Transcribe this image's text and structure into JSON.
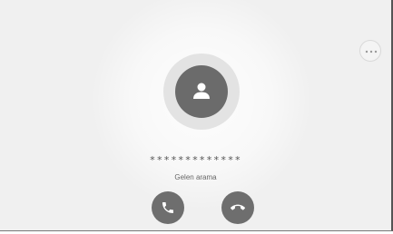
{
  "call": {
    "caller_number": "*************",
    "status": "Gelen arama"
  },
  "icons": {
    "avatar": "person-icon",
    "more": "ellipsis-icon",
    "answer": "phone-answer-icon",
    "decline": "phone-hangup-icon"
  },
  "colors": {
    "background": "#f0f0f0",
    "button": "#6e6e6e",
    "avatar": "#6b6b6b"
  }
}
